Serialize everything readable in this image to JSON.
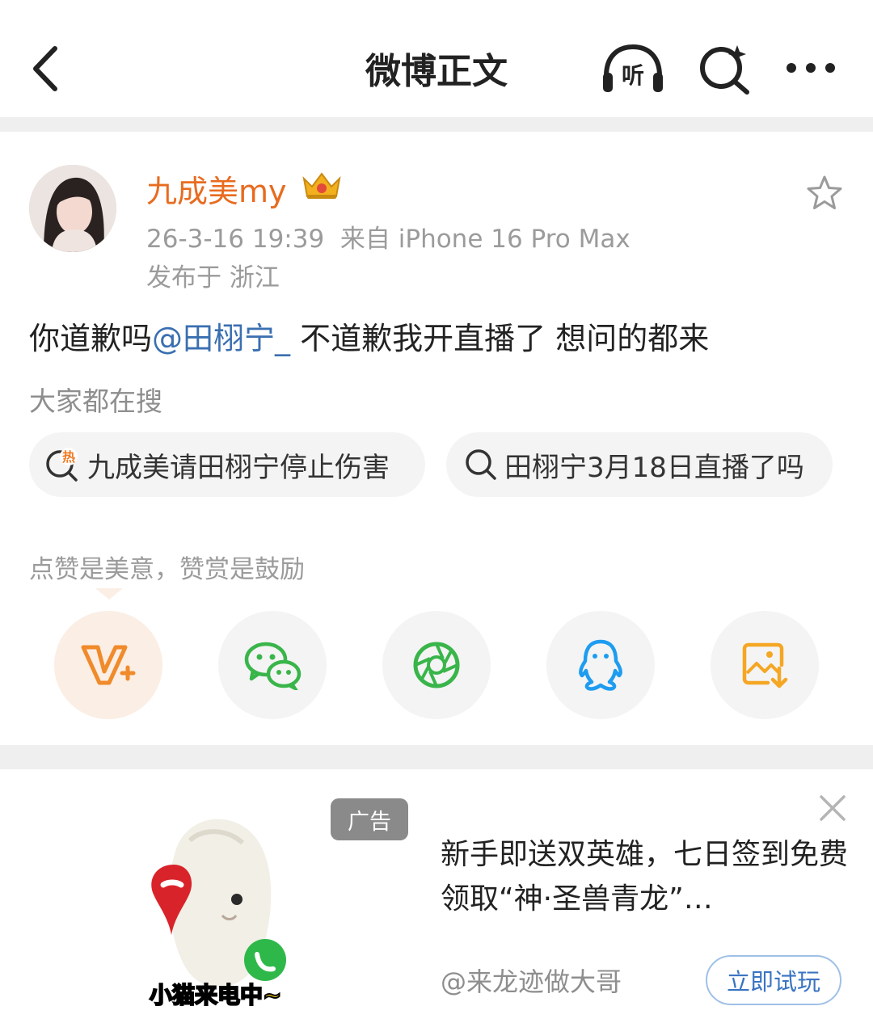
{
  "header": {
    "title": "微博正文",
    "listen_label": "听",
    "back_icon": "chevron-left-icon",
    "more_icon": "ellipsis-icon",
    "search_icon": "ai-search-icon"
  },
  "post": {
    "username": "九成美my",
    "time": "26-3-16 19:39",
    "source": "来自 iPhone 16 Pro Max",
    "location": "发布于 浙江",
    "content_before": "你道歉吗",
    "mention": "@田栩宁_",
    "content_after": " 不道歉我开直播了 想问的都来"
  },
  "search": {
    "hint": "大家都在搜",
    "chips": [
      {
        "icon_text": "热",
        "text": "九成美请田栩宁停止伤害"
      },
      {
        "text": "田栩宁3月18日直播了吗"
      }
    ]
  },
  "reward": {
    "text": "点赞是美意，赞赏是鼓励"
  },
  "share": {
    "items": [
      {
        "icon": "weibo-reward-icon"
      },
      {
        "icon": "wechat-icon"
      },
      {
        "icon": "moments-icon"
      },
      {
        "icon": "qq-icon"
      },
      {
        "icon": "save-image-icon"
      }
    ]
  },
  "ad": {
    "tag": "广告",
    "text": "新手即送双英雄，七日签到免费领取“神·圣兽青龙”…",
    "source": "@来龙迹做大哥",
    "button": "立即试玩",
    "image_caption": "小猫来电中~"
  },
  "colors": {
    "brand_orange": "#e86b1f",
    "mention_blue": "#3a6fb0",
    "wechat_green": "#39b54a",
    "qq_blue": "#1e9cf0",
    "save_orange": "#f5a623"
  }
}
